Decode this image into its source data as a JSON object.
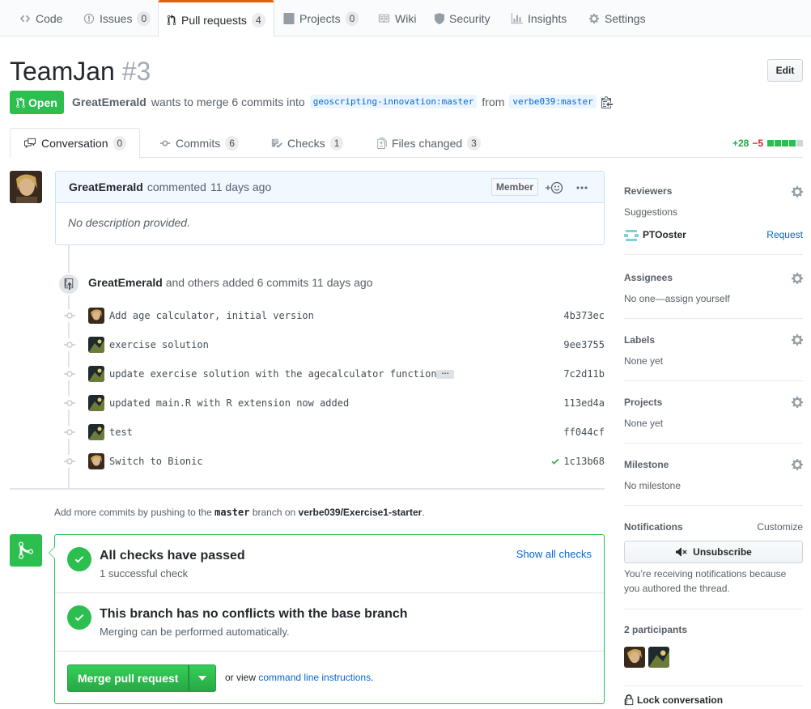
{
  "repo_nav": {
    "code": "Code",
    "issues": "Issues",
    "issues_count": "0",
    "pulls": "Pull requests",
    "pulls_count": "4",
    "projects": "Projects",
    "projects_count": "0",
    "wiki": "Wiki",
    "security": "Security",
    "insights": "Insights",
    "settings": "Settings"
  },
  "pr": {
    "title": "TeamJan",
    "number": "#3",
    "edit_label": "Edit",
    "state": "Open",
    "author": "GreatEmerald",
    "merge_text": "wants to merge 6 commits into",
    "base_branch": "geoscripting-innovation:master",
    "from_text": "from",
    "head_branch": "verbe039:master"
  },
  "tabs": {
    "conversation": "Conversation",
    "conversation_count": "0",
    "commits": "Commits",
    "commits_count": "6",
    "checks": "Checks",
    "checks_count": "1",
    "files": "Files changed",
    "files_count": "3"
  },
  "diffstat": {
    "additions": "+28",
    "deletions": "−5"
  },
  "comment": {
    "author": "GreatEmerald",
    "action": "commented",
    "time": "11 days ago",
    "badge": "Member",
    "body": "No description provided."
  },
  "push_event": {
    "author": "GreatEmerald",
    "text": "and others added 6 commits",
    "time": "11 days ago"
  },
  "commits": [
    {
      "message": "Add age calculator, initial version",
      "sha": "4b373ec"
    },
    {
      "message": "exercise solution",
      "sha": "9ee3755"
    },
    {
      "message": "update exercise solution with the agecalculator function",
      "sha": "7c2d11b"
    },
    {
      "message": "updated main.R with R extension now added",
      "sha": "113ed4a"
    },
    {
      "message": "test",
      "sha": "ff044cf"
    },
    {
      "message": "Switch to Bionic",
      "sha": "1c13b68"
    }
  ],
  "more_commits": {
    "prefix": "Add more commits by pushing to the",
    "branch": "master",
    "middle": "branch on",
    "repo": "verbe039/Exercise1-starter",
    "suffix": "."
  },
  "merge": {
    "checks_title": "All checks have passed",
    "checks_sub": "1 successful check",
    "show_all": "Show all checks",
    "conflicts_title": "This branch has no conflicts with the base branch",
    "conflicts_sub": "Merging can be performed automatically.",
    "button": "Merge pull request",
    "or_view": "or view",
    "cli_link": "command line instructions",
    "period": "."
  },
  "sidebar": {
    "reviewers": "Reviewers",
    "suggestions": "Suggestions",
    "suggested_user": "PTOoster",
    "request": "Request",
    "assignees": "Assignees",
    "assignees_value": "No one—assign yourself",
    "labels": "Labels",
    "labels_value": "None yet",
    "projects": "Projects",
    "projects_value": "None yet",
    "milestone": "Milestone",
    "milestone_value": "No milestone",
    "notifications": "Notifications",
    "customize": "Customize",
    "unsubscribe": "Unsubscribe",
    "notif_line1": "You’re receiving notifications because",
    "notif_line2": "you authored the thread.",
    "participants": "2 participants",
    "lock": "Lock conversation"
  },
  "colors": {
    "open_green": "#2cbe4e",
    "link_blue": "#0366d6",
    "nav_accent": "#e36209",
    "deletion_red": "#cb2431"
  }
}
